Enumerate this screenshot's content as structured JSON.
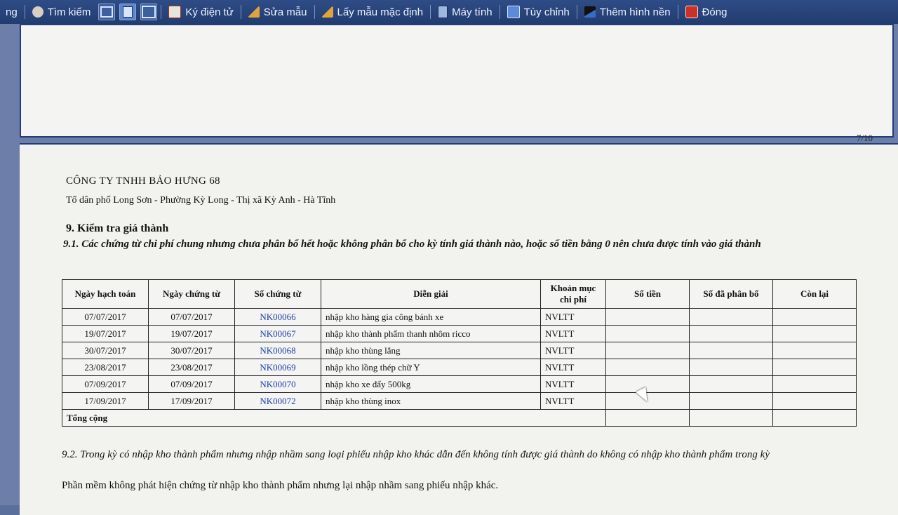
{
  "toolbar": {
    "left_partial": "ng",
    "search": "Tìm kiếm",
    "sign": "Ký điện tử",
    "edit_template": "Sửa mẫu",
    "default_template": "Lấy mẫu mặc định",
    "calculator": "Máy tính",
    "customize": "Tùy chỉnh",
    "add_background": "Thêm hình nền",
    "close": "Đóng"
  },
  "page": {
    "page_number": "7/10"
  },
  "report": {
    "company": "CÔNG TY TNHH BẢO HƯNG 68",
    "address": "Tổ dân phố Long Sơn - Phường Kỳ Long - Thị xã Kỳ Anh - Hà Tĩnh",
    "section_9": "9. Kiểm tra giá thành",
    "section_9_1": "9.1. Các chứng từ chi phí chung nhưng chưa phân bổ hết hoặc không phân bổ cho kỳ tính giá thành nào, hoặc số tiền bằng 0 nên chưa được tính vào giá thành",
    "table": {
      "headers": [
        "Ngày hạch toán",
        "Ngày chứng từ",
        "Số chứng từ",
        "Diễn giải",
        "Khoản mục chi phí",
        "Số tiền",
        "Số đã phân bổ",
        "Còn lại"
      ],
      "rows": [
        [
          "07/07/2017",
          "07/07/2017",
          "NK00066",
          "nhập kho hàng gia công bánh xe",
          "NVLTT",
          "",
          "",
          ""
        ],
        [
          "19/07/2017",
          "19/07/2017",
          "NK00067",
          "nhập kho thành phẩm thanh nhôm ricco",
          "NVLTT",
          "",
          "",
          ""
        ],
        [
          "30/07/2017",
          "30/07/2017",
          "NK00068",
          "nhập kho thùng lắng",
          "NVLTT",
          "",
          "",
          ""
        ],
        [
          "23/08/2017",
          "23/08/2017",
          "NK00069",
          "nhập kho lồng thép chữ Y",
          "NVLTT",
          "",
          "",
          ""
        ],
        [
          "07/09/2017",
          "07/09/2017",
          "NK00070",
          "nhập kho xe đẩy 500kg",
          "NVLTT",
          "",
          "",
          ""
        ],
        [
          "17/09/2017",
          "17/09/2017",
          "NK00072",
          "nhập kho thùng inox",
          "NVLTT",
          "",
          "",
          ""
        ]
      ],
      "total_label": "Tổng cộng"
    },
    "section_9_2": "9.2. Trong kỳ có nhập kho thành phẩm nhưng nhập nhầm sang loại phiếu nhập kho khác dẫn đến không tính được giá thành do không có nhập kho thành phẩm trong kỳ",
    "note_9_2": "Phần mềm không phát hiện chứng từ nhập kho thành phẩm nhưng lại nhập nhầm sang phiếu nhập khác."
  }
}
